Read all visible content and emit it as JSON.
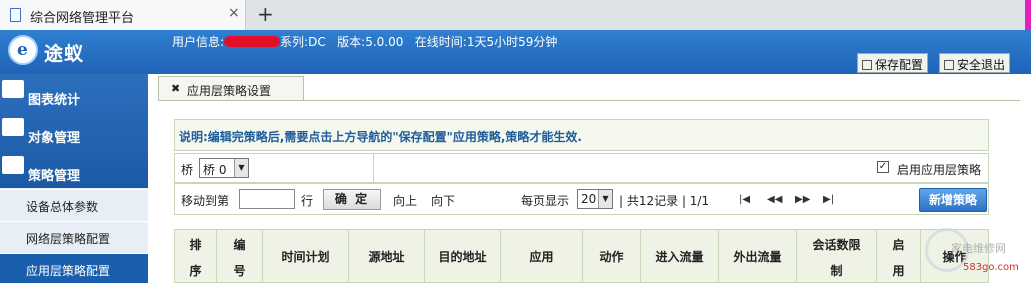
{
  "browser": {
    "tab_title": "综合网络管理平台",
    "close_glyph": "×",
    "new_tab_glyph": "+"
  },
  "header": {
    "logo_letter": "e",
    "logo_text": "途蚁",
    "info_user_label": "用户信息:",
    "info_rest": "系列:DC   版本:5.0.00   在线时间:1天5小时59分钟",
    "save_config": "保存配置",
    "safe_exit": "安全退出"
  },
  "sidebar": {
    "items": [
      {
        "label": "图表统计",
        "icon": "bar-chart-icon"
      },
      {
        "label": "对象管理",
        "icon": "objects-icon"
      },
      {
        "label": "策略管理",
        "icon": "policy-icon"
      }
    ],
    "subitems": [
      {
        "label": "设备总体参数",
        "active": false
      },
      {
        "label": "网络层策略配置",
        "active": false
      },
      {
        "label": "应用层策略配置",
        "active": true
      }
    ]
  },
  "content": {
    "tab_label": "应用层策略设置",
    "note": "说明:编辑完策略后,需要点击上方导航的\"保存配置\"应用策略,策略才能生效.",
    "bridge_label": "桥",
    "bridge_select": "桥 0",
    "enable_checkbox_glyph": "✓",
    "enable_label": "启用应用层策略",
    "goto_label": "移动到第",
    "goto_unit": "行",
    "confirm": "确 定",
    "move_up": "向上",
    "move_down": "向下",
    "per_page_label": "每页显示",
    "per_page_value": "20",
    "record_info": "| 共12记录 | 1/1",
    "add_policy": "新增策略",
    "columns": [
      {
        "l1": "排",
        "l2": "序"
      },
      {
        "l1": "编",
        "l2": "号"
      },
      {
        "text": "时间计划"
      },
      {
        "text": "源地址"
      },
      {
        "text": "目的地址"
      },
      {
        "text": "应用"
      },
      {
        "text": "动作"
      },
      {
        "text": "进入流量"
      },
      {
        "text": "外出流量"
      },
      {
        "l1": "会话数限",
        "l2": "制"
      },
      {
        "l1": "启",
        "l2": "用"
      },
      {
        "text": "操作"
      }
    ]
  },
  "watermark": {
    "text": "家电维修网",
    "site": "583go.com"
  }
}
